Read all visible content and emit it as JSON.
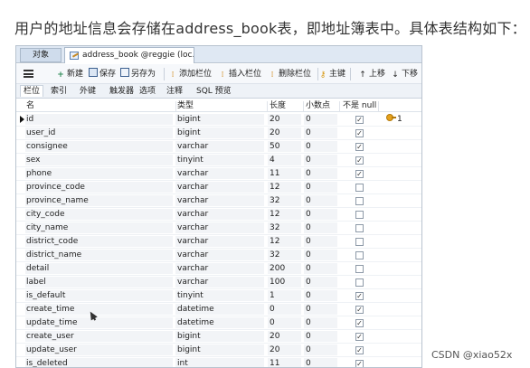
{
  "intro_text": "用户的地址信息会存储在address_book表，即地址簿表中。具体表结构如下：",
  "window": {
    "tabs": {
      "object_tab": "对象",
      "active_tab": "address_book @reggie (loc..."
    },
    "toolbar": {
      "new": "新建",
      "save": "保存",
      "save_as": "另存为",
      "add_field": "添加栏位",
      "insert_field": "插入栏位",
      "delete_field": "删除栏位",
      "primary_key": "主键",
      "move_up": "上移",
      "move_down": "下移"
    },
    "subtabs": [
      "栏位",
      "索引",
      "外键",
      "触发器",
      "选项",
      "注释",
      "SQL 预览"
    ],
    "columns": {
      "name": "名",
      "type": "类型",
      "length": "长度",
      "decimals": "小数点",
      "not_null": "不是 null"
    },
    "rows": [
      {
        "name": "id",
        "type": "bigint",
        "length": "20",
        "decimals": "0",
        "not_null": true,
        "key": "1"
      },
      {
        "name": "user_id",
        "type": "bigint",
        "length": "20",
        "decimals": "0",
        "not_null": true,
        "key": ""
      },
      {
        "name": "consignee",
        "type": "varchar",
        "length": "50",
        "decimals": "0",
        "not_null": true,
        "key": ""
      },
      {
        "name": "sex",
        "type": "tinyint",
        "length": "4",
        "decimals": "0",
        "not_null": true,
        "key": ""
      },
      {
        "name": "phone",
        "type": "varchar",
        "length": "11",
        "decimals": "0",
        "not_null": true,
        "key": ""
      },
      {
        "name": "province_code",
        "type": "varchar",
        "length": "12",
        "decimals": "0",
        "not_null": false,
        "key": ""
      },
      {
        "name": "province_name",
        "type": "varchar",
        "length": "32",
        "decimals": "0",
        "not_null": false,
        "key": ""
      },
      {
        "name": "city_code",
        "type": "varchar",
        "length": "12",
        "decimals": "0",
        "not_null": false,
        "key": ""
      },
      {
        "name": "city_name",
        "type": "varchar",
        "length": "32",
        "decimals": "0",
        "not_null": false,
        "key": ""
      },
      {
        "name": "district_code",
        "type": "varchar",
        "length": "12",
        "decimals": "0",
        "not_null": false,
        "key": ""
      },
      {
        "name": "district_name",
        "type": "varchar",
        "length": "32",
        "decimals": "0",
        "not_null": false,
        "key": ""
      },
      {
        "name": "detail",
        "type": "varchar",
        "length": "200",
        "decimals": "0",
        "not_null": false,
        "key": ""
      },
      {
        "name": "label",
        "type": "varchar",
        "length": "100",
        "decimals": "0",
        "not_null": false,
        "key": ""
      },
      {
        "name": "is_default",
        "type": "tinyint",
        "length": "1",
        "decimals": "0",
        "not_null": true,
        "key": ""
      },
      {
        "name": "create_time",
        "type": "datetime",
        "length": "0",
        "decimals": "0",
        "not_null": true,
        "key": ""
      },
      {
        "name": "update_time",
        "type": "datetime",
        "length": "0",
        "decimals": "0",
        "not_null": true,
        "key": ""
      },
      {
        "name": "create_user",
        "type": "bigint",
        "length": "20",
        "decimals": "0",
        "not_null": true,
        "key": ""
      },
      {
        "name": "update_user",
        "type": "bigint",
        "length": "20",
        "decimals": "0",
        "not_null": true,
        "key": ""
      },
      {
        "name": "is_deleted",
        "type": "int",
        "length": "11",
        "decimals": "0",
        "not_null": true,
        "key": ""
      }
    ]
  },
  "watermark": "CSDN @xiao52x"
}
